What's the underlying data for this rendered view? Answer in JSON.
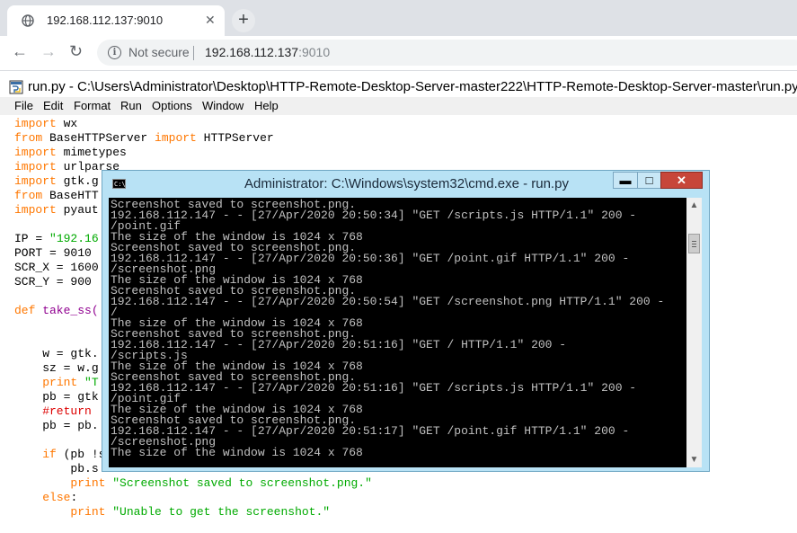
{
  "browser": {
    "tab_title": "192.168.112.137:9010",
    "tab_close": "✕",
    "new_tab": "+",
    "back": "←",
    "forward": "→",
    "reload": "↻",
    "security_label": "Not secure",
    "url_host": "192.168.112.137",
    "url_port": ":9010"
  },
  "idle": {
    "title": "run.py - C:\\Users\\Administrator\\Desktop\\HTTP-Remote-Desktop-Server-master222\\HTTP-Remote-Desktop-Server-master\\run.py",
    "menu": [
      "File",
      "Edit",
      "Format",
      "Run",
      "Options",
      "Window",
      "Help"
    ]
  },
  "code": {
    "l1": {
      "a": "import",
      "b": " wx"
    },
    "l2": {
      "a": "from",
      "b": " BaseHTTPServer ",
      "c": "import",
      "d": " HTTPServer"
    },
    "l3": {
      "a": "import",
      "b": " mimetypes"
    },
    "l4": {
      "a": "import",
      "b": " urlparse"
    },
    "l5": {
      "a": "import",
      "b": " gtk.g"
    },
    "l6": {
      "a": "from",
      "b": " BaseHTT"
    },
    "l7": {
      "a": "import",
      "b": " pyaut"
    },
    "l8": {
      "a": "IP = ",
      "b": "\"192.16"
    },
    "l9": "PORT = 9010",
    "l10": "SCR_X = 1600",
    "l11": "SCR_Y = 900",
    "l12": {
      "a": "def",
      "b": " take_ss("
    },
    "l13": "    w = gtk.",
    "l14": "    sz = w.g",
    "l15": {
      "a": "    ",
      "b": "print",
      "c": " \"T"
    },
    "l16": "    pb = gtk",
    "l17": "    #return",
    "l18": "    pb = pb.",
    "l19": {
      "a": "    ",
      "b": "if",
      "c": " (pb !s"
    },
    "l20": "        pb.s",
    "l21": {
      "a": "        ",
      "b": "print",
      "c": " ",
      "d": "\"Screenshot saved to screenshot.png.\""
    },
    "l22": {
      "a": "    ",
      "b": "else",
      "c": ":"
    },
    "l23": {
      "a": "        ",
      "b": "print",
      "c": " ",
      "d": "\"Unable to get the screenshot.\""
    }
  },
  "cmd": {
    "title": "Administrator: C:\\Windows\\system32\\cmd.exe - run.py",
    "icon_text": "C:\\",
    "min": "▬",
    "max": "□",
    "close": "✕",
    "lines": [
      "Screenshot saved to screenshot.png.",
      "192.168.112.147 - - [27/Apr/2020 20:50:34] \"GET /scripts.js HTTP/1.1\" 200 -",
      "/point.gif",
      "The size of the window is 1024 x 768",
      "Screenshot saved to screenshot.png.",
      "192.168.112.147 - - [27/Apr/2020 20:50:36] \"GET /point.gif HTTP/1.1\" 200 -",
      "/screenshot.png",
      "The size of the window is 1024 x 768",
      "Screenshot saved to screenshot.png.",
      "192.168.112.147 - - [27/Apr/2020 20:50:54] \"GET /screenshot.png HTTP/1.1\" 200 -",
      "/",
      "The size of the window is 1024 x 768",
      "Screenshot saved to screenshot.png.",
      "192.168.112.147 - - [27/Apr/2020 20:51:16] \"GET / HTTP/1.1\" 200 -",
      "/scripts.js",
      "The size of the window is 1024 x 768",
      "Screenshot saved to screenshot.png.",
      "192.168.112.147 - - [27/Apr/2020 20:51:16] \"GET /scripts.js HTTP/1.1\" 200 -",
      "/point.gif",
      "The size of the window is 1024 x 768",
      "Screenshot saved to screenshot.png.",
      "192.168.112.147 - - [27/Apr/2020 20:51:17] \"GET /point.gif HTTP/1.1\" 200 -",
      "/screenshot.png",
      "The size of the window is 1024 x 768"
    ],
    "scroll_up": "▲",
    "scroll_down": "▼"
  }
}
